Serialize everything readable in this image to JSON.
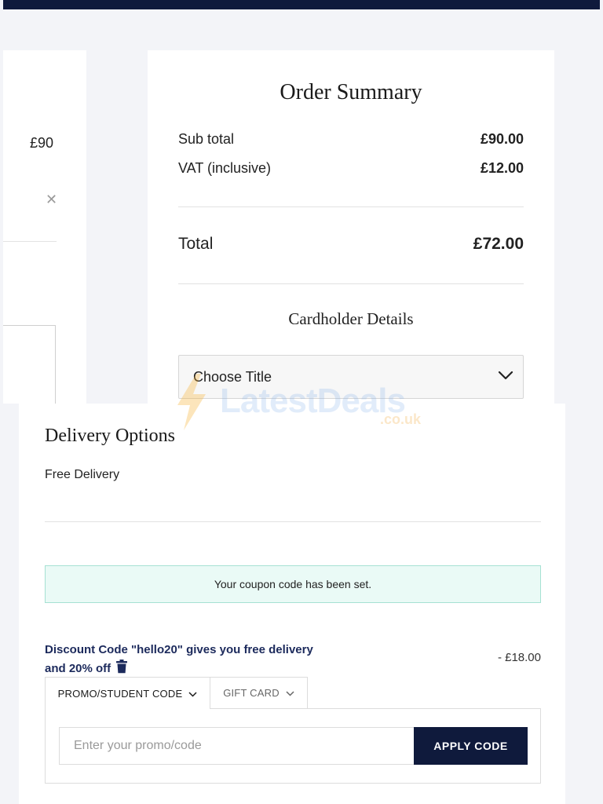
{
  "left_panel": {
    "price": "£90",
    "remove_icon": "close-icon"
  },
  "order_summary": {
    "title": "Order Summary",
    "subtotal_label": "Sub total",
    "subtotal_value": "£90.00",
    "vat_label": "VAT (inclusive)",
    "vat_value": "£12.00",
    "total_label": "Total",
    "total_value": "£72.00"
  },
  "cardholder": {
    "title": "Cardholder Details",
    "title_select_value": "Choose Title",
    "select_icon": "chevron-down-icon"
  },
  "watermark": {
    "brand": "LatestDeals",
    "suffix": ".co.uk"
  },
  "delivery": {
    "title": "Delivery Options",
    "option": "Free Delivery"
  },
  "coupon": {
    "banner": "Your coupon code has been set.",
    "discount_line1": "Discount Code \"hello20\" gives you free delivery",
    "discount_line2": "and 20% off",
    "discount_amount": "- £18.00",
    "delete_icon": "trash-icon"
  },
  "promo": {
    "tab_promo": "PROMO/STUDENT CODE",
    "tab_gift": "GIFT CARD",
    "input_placeholder": "Enter your promo/code",
    "input_value": "",
    "apply_label": "APPLY CODE"
  },
  "colors": {
    "navy": "#0f1a3c",
    "discount_text": "#1c2a5c",
    "banner_bg": "#eafaf6",
    "banner_border": "#a6e1d3"
  }
}
